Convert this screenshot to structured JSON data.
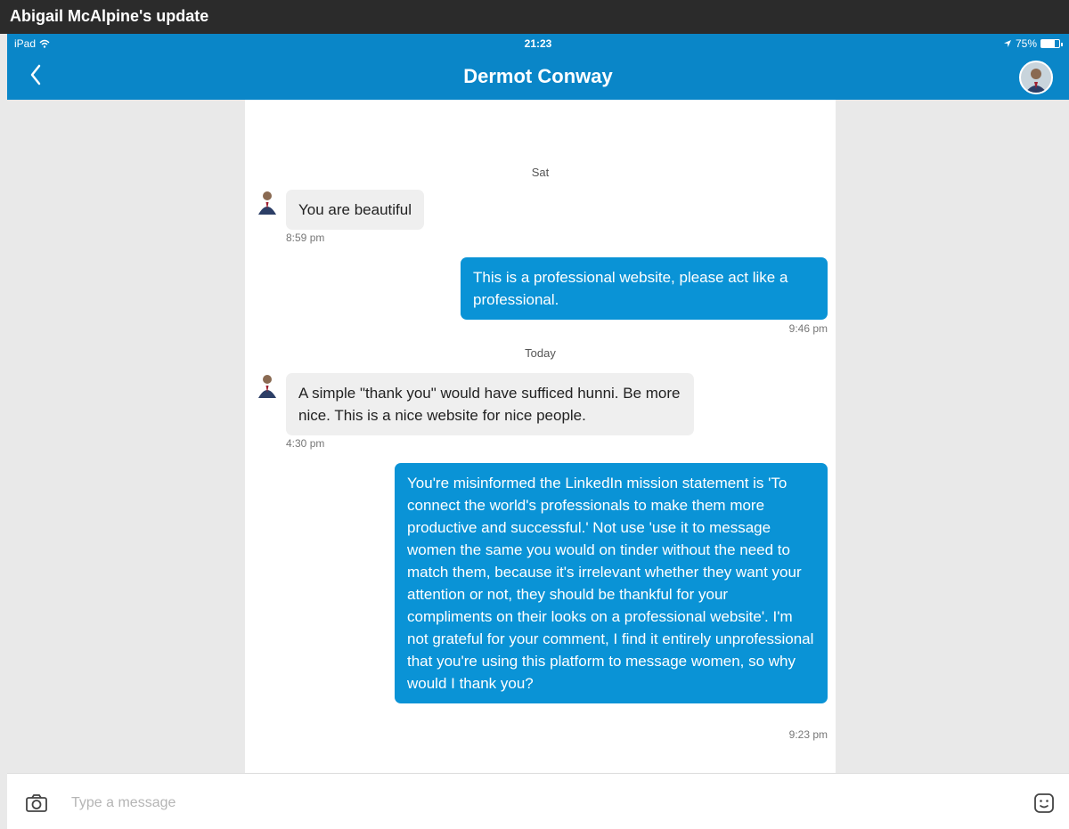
{
  "window": {
    "title": "Abigail McAlpine's update"
  },
  "status_bar": {
    "device": "iPad",
    "time": "21:23",
    "battery": "75%",
    "battery_level": 0.75
  },
  "nav": {
    "title": "Dermot Conway"
  },
  "messages": [
    {
      "type": "date",
      "text": "Sat"
    },
    {
      "type": "incoming",
      "text": "You are beautiful",
      "time": "8:59 pm"
    },
    {
      "type": "outgoing",
      "text": "This is a professional website, please act like a professional.",
      "time": "9:46 pm"
    },
    {
      "type": "date",
      "text": "Today"
    },
    {
      "type": "incoming",
      "text": "A simple \"thank you\" would have sufficed hunni. Be more nice. This is a nice website for nice people.",
      "time": "4:30 pm"
    },
    {
      "type": "outgoing",
      "text": "You're misinformed the LinkedIn mission statement is 'To connect the world's professionals to make them more productive and successful.' Not use 'use it to message women the same you would on tinder without the need to match them, because it's irrelevant whether they want your attention or not, they should be thankful for your compliments on their looks on a professional website'. I'm not grateful for your comment, I find it entirely unprofessional that you're using this platform to message women, so why would I thank you?",
      "time": "9:23 pm"
    }
  ],
  "composer": {
    "placeholder": "Type a message"
  },
  "colors": {
    "accent": "#0a86c8",
    "outgoing_bubble": "#0a93d6",
    "incoming_bubble": "#efefef"
  },
  "icons": {
    "back": "chevron-left-icon",
    "camera": "camera-icon",
    "emoji": "emoji-icon",
    "wifi": "wifi-icon",
    "location": "location-arrow-icon"
  }
}
